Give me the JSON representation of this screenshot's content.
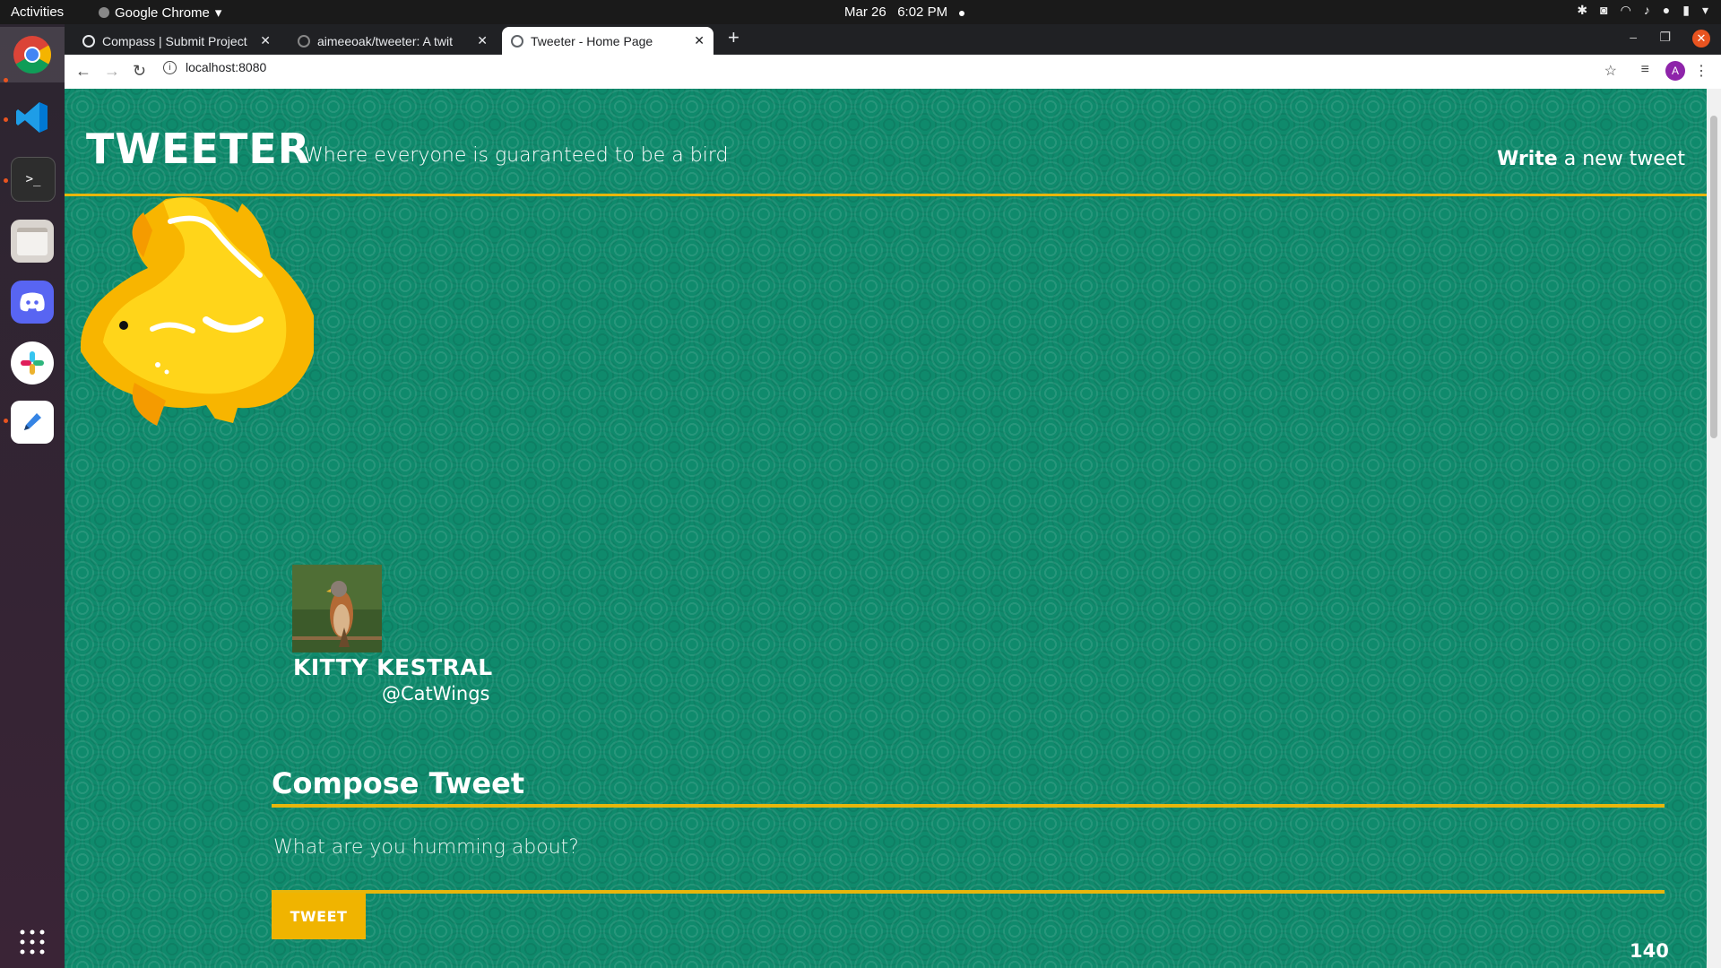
{
  "system_bar": {
    "activities": "Activities",
    "app_name": "Google Chrome",
    "date": "Mar 26",
    "time": "6:02 PM"
  },
  "browser": {
    "tabs": [
      {
        "title": "Compass | Submit Project",
        "active": false
      },
      {
        "title": "aimeeoak/tweeter: A twit",
        "active": false
      },
      {
        "title": "Tweeter - Home Page",
        "active": true
      }
    ],
    "url": "localhost:8080",
    "profile_initial": "A"
  },
  "site": {
    "brand": "TWEETER",
    "tagline": "Where everyone is guaranteed to be a bird",
    "nav_write_strong": "Write",
    "nav_write_rest": "a new tweet"
  },
  "profile": {
    "name": "KITTY KESTRAL",
    "handle": "@CatWings"
  },
  "compose": {
    "title": "Compose Tweet",
    "placeholder": "What are you humming about?",
    "button_label": "TWEET",
    "counter": "140"
  },
  "colors": {
    "page_background": "#0f8a6c",
    "accent_gold": "#e8b60c",
    "button_gold": "#f0b400"
  }
}
